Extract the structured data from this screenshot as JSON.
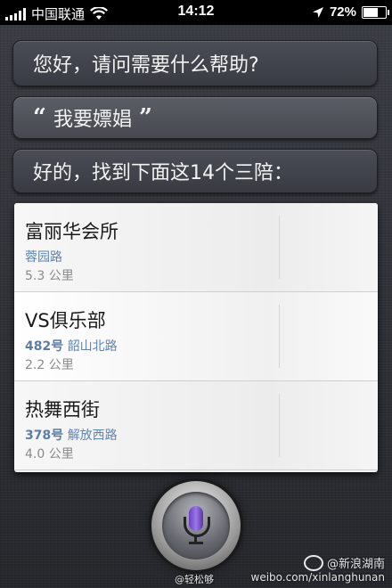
{
  "status_bar": {
    "carrier": "中国联通",
    "time": "14:12",
    "battery": "72%",
    "battery_level": 0.72
  },
  "conversation": {
    "siri_greeting": "您好，请问需要什么帮助?",
    "user_request": "我要嫖娼",
    "quote_open": "“",
    "quote_close": "”",
    "siri_reply": "好的，找到下面这14个三陪："
  },
  "results": [
    {
      "name": "富丽华会所",
      "num": "",
      "street": "蓉园路",
      "distance": "5.3 公里"
    },
    {
      "name": "VS俱乐部",
      "num": "482号",
      "street": "韶山北路",
      "distance": "2.2 公里"
    },
    {
      "name": "热舞西街",
      "num": "378号",
      "street": "解放西路",
      "distance": "4.0 公里"
    }
  ],
  "watermark": {
    "weibo_name": "@新浪湖南",
    "url": "weibo.com/xinlanghunan",
    "left_text": "@轻松够"
  },
  "icons": {
    "signal": "signal-bars-icon",
    "wifi": "wifi-icon",
    "location": "location-arrow-icon",
    "battery": "battery-icon",
    "mic": "microphone-icon"
  },
  "colors": {
    "mic_accent": "#7a55d8",
    "address_link": "#5b85b5"
  }
}
